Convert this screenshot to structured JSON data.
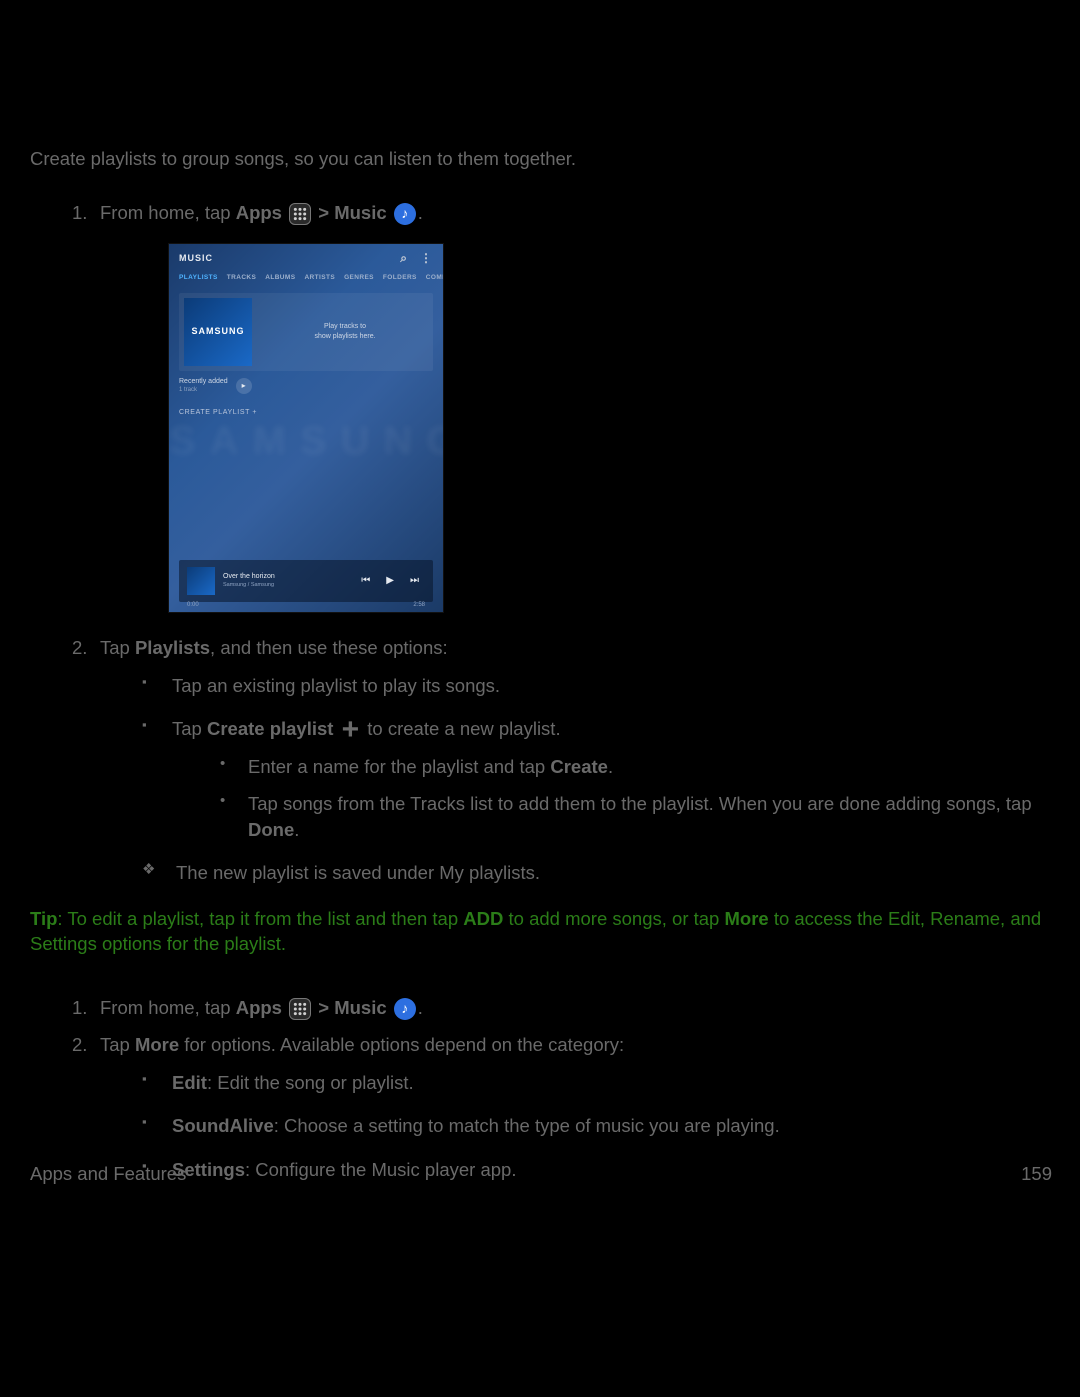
{
  "intro": "Create playlists to group songs, so you can listen to them together.",
  "step1": {
    "prefix": "From home, tap ",
    "apps": "Apps",
    "sep": " > ",
    "music": "Music",
    "tail": "."
  },
  "screenshot": {
    "title": "MUSIC",
    "tabs": [
      "PLAYLISTS",
      "TRACKS",
      "ALBUMS",
      "ARTISTS",
      "GENRES",
      "FOLDERS",
      "COMPOSERS"
    ],
    "panel_brand": "SAMSUNG",
    "panel_msg_l1": "Play tracks to",
    "panel_msg_l2": "show playlists here.",
    "recent_title": "Recently added",
    "recent_sub": "1 track",
    "create": "CREATE PLAYLIST   +",
    "ghost": "SAMSUNG",
    "now_title": "Over the horizon",
    "now_sub": "Samsung / Samsung",
    "t_start": "0:00",
    "t_end": "2:58"
  },
  "step2_lead_a": "Tap ",
  "step2_lead_bold": "Playlists",
  "step2_lead_b": ", and then use these options:",
  "s2_b1": "Tap an existing playlist to play its songs.",
  "s2_b2_a": "Tap ",
  "s2_b2_bold": "Create playlist",
  "s2_b2_b": " to create a new playlist.",
  "s2_d1_a": "Enter a name for the playlist and tap ",
  "s2_d1_bold": "Create",
  "s2_d1_b": ".",
  "s2_d2_a": "Tap songs from the Tracks list to add them to the playlist. When you are done adding songs, tap ",
  "s2_d2_bold": "Done",
  "s2_d2_b": ".",
  "s2_diamond": "The new playlist is saved under My playlists.",
  "tip_label": "Tip",
  "tip_a": ": To edit a playlist, tap it from the list and then tap ",
  "tip_add": "ADD",
  "tip_b": " to add more songs, or tap ",
  "tip_more": "More",
  "tip_c": " to access the Edit, Rename, and Settings options for the playlist.",
  "sec2_step2_a": "Tap ",
  "sec2_step2_bold": "More",
  "sec2_step2_b": " for options. Available options depend on the category:",
  "opt_edit_b": "Edit",
  "opt_edit_t": ": Edit the song or playlist.",
  "opt_sa_b": "SoundAlive",
  "opt_sa_t": ": Choose a setting to match the type of music you are playing.",
  "opt_set_b": "Settings",
  "opt_set_t": ": Configure the Music player app.",
  "footer_left": "Apps and Features",
  "footer_right": "159"
}
